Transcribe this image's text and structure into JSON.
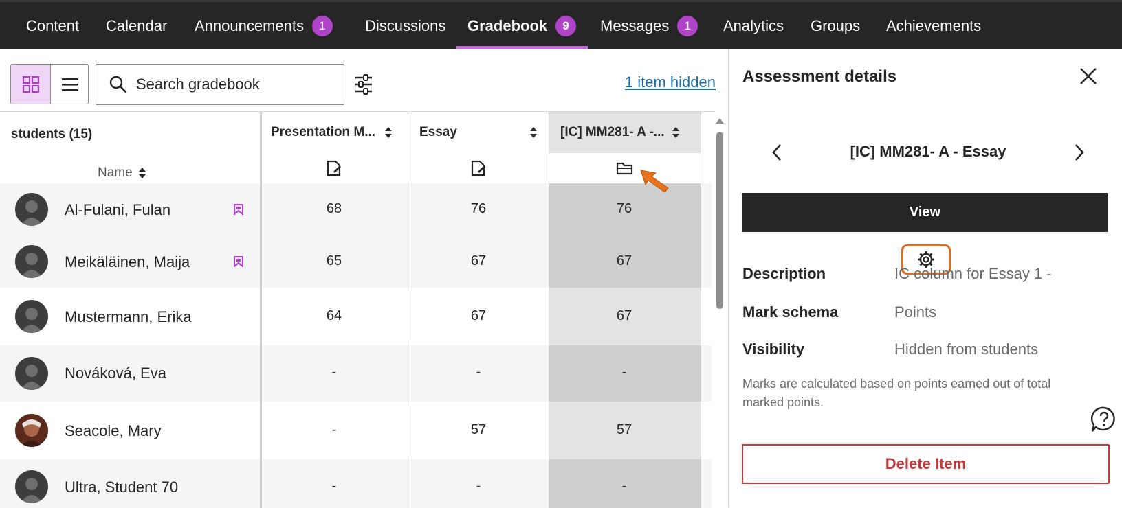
{
  "nav": {
    "tabs": [
      {
        "label": "Content"
      },
      {
        "label": "Calendar"
      },
      {
        "label": "Announcements",
        "badge": "1"
      },
      {
        "label": "Discussions"
      },
      {
        "label": "Gradebook",
        "badge": "9",
        "active": true
      },
      {
        "label": "Messages",
        "badge": "1"
      },
      {
        "label": "Analytics"
      },
      {
        "label": "Groups"
      },
      {
        "label": "Achievements"
      }
    ]
  },
  "toolbar": {
    "search_placeholder": "Search gradebook",
    "hidden_link": "1 item hidden"
  },
  "grid": {
    "students_header": "students (15)",
    "name_sort_label": "Name",
    "columns": [
      {
        "title": "Presentation M...",
        "icon": "assignment-icon"
      },
      {
        "title": "Essay",
        "icon": "assignment-icon"
      },
      {
        "title": "[IC] MM281- A -...",
        "icon": "folder-icon"
      }
    ],
    "rows": [
      {
        "name": "Al-Fulani, Fulan",
        "flagged": true,
        "values": [
          "68",
          "76",
          "76"
        ]
      },
      {
        "name": "Meikäläinen, Maija",
        "flagged": true,
        "values": [
          "65",
          "67",
          "67"
        ]
      },
      {
        "name": "Mustermann, Erika",
        "flagged": false,
        "values": [
          "64",
          "67",
          "67"
        ]
      },
      {
        "name": "Nováková, Eva",
        "flagged": false,
        "values": [
          "-",
          "-",
          "-"
        ]
      },
      {
        "name": "Seacole, Mary",
        "flagged": false,
        "values": [
          "-",
          "57",
          "57"
        ]
      },
      {
        "name": "Ultra, Student 70",
        "flagged": false,
        "values": [
          "-",
          "-",
          "-"
        ]
      }
    ]
  },
  "panel": {
    "title": "Assessment details",
    "item_title": "[IC] MM281- A - Essay",
    "view_label": "View",
    "details": [
      {
        "label": "Description",
        "value": "IC column for Essay 1 -"
      },
      {
        "label": "Mark schema",
        "value": "Points"
      },
      {
        "label": "Visibility",
        "value": "Hidden from students"
      }
    ],
    "visibility_note": "Marks are calculated based on points earned out of total marked points.",
    "delete_label": "Delete Item"
  },
  "colors": {
    "nav_bg": "#262626",
    "accent_purple": "#b044c8",
    "highlight_orange": "#dc6d26",
    "delete_red": "#c23a3a",
    "link_blue": "#1a6ea8"
  }
}
